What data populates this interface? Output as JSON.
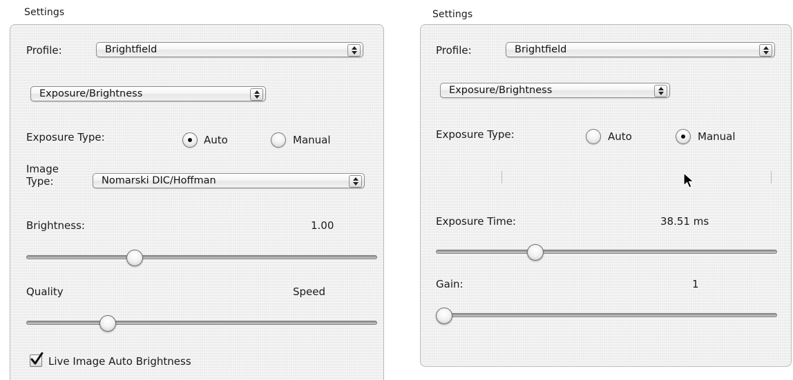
{
  "left": {
    "title": "Settings",
    "profile_label": "Profile:",
    "profile_value": "Brightfield",
    "mode_value": "Exposure/Brightness",
    "exposure_type_label": "Exposure Type:",
    "radio_auto": "Auto",
    "radio_manual": "Manual",
    "exposure_selected": "Auto",
    "image_type_label": "Image Type:",
    "image_type_value": "Nomarski DIC/Hoffman",
    "brightness_label": "Brightness:",
    "brightness_value": "1.00",
    "brightness_slider_fraction": 0.3,
    "quality_label": "Quality",
    "speed_label": "Speed",
    "quality_slider_fraction": 0.22,
    "live_auto_brightness_label": "Live Image Auto Brightness",
    "live_auto_brightness_checked": true
  },
  "right": {
    "title": "Settings",
    "profile_label": "Profile:",
    "profile_value": "Brightfield",
    "mode_value": "Exposure/Brightness",
    "exposure_type_label": "Exposure Type:",
    "radio_auto": "Auto",
    "radio_manual": "Manual",
    "exposure_selected": "Manual",
    "exposure_time_label": "Exposure Time:",
    "exposure_time_value": "38.51 ms",
    "exposure_time_slider_fraction": 0.28,
    "gain_label": "Gain:",
    "gain_value": "1",
    "gain_slider_fraction": 0.0
  },
  "icons": {
    "cursor": "arrow-cursor-icon",
    "check": "checkmark-icon",
    "popup_arrows": "up-down-arrows-icon"
  }
}
